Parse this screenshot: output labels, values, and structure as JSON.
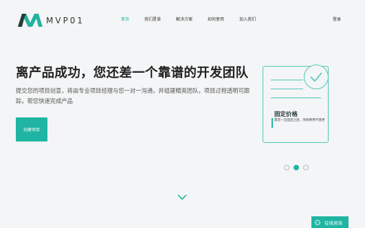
{
  "brand": {
    "name": "MVP01",
    "accent": "#1fb5a2"
  },
  "nav": {
    "items": [
      {
        "label": "首页",
        "active": true
      },
      {
        "label": "我们是谁",
        "active": false
      },
      {
        "label": "解决方案",
        "active": false
      },
      {
        "label": "如何使用",
        "active": false
      },
      {
        "label": "加入我们",
        "active": false
      }
    ],
    "login": "登录"
  },
  "hero": {
    "title": "离产品成功，您还差一个靠谱的开发团队",
    "description": "提交您的项目创意，将由专业项目经理与您一对一沟通，并组建精英团队，项目过程透明可跟踪，帮您快速完成产品",
    "cta": "创建项目"
  },
  "feature_card": {
    "title": "固定价格",
    "text": "需求一旦固定之后，项目费用不变更",
    "icon": "check-icon"
  },
  "carousel": {
    "active_index": 1,
    "count": 3
  },
  "consult": {
    "label": "在线咨询",
    "icon": "chat-icon"
  }
}
